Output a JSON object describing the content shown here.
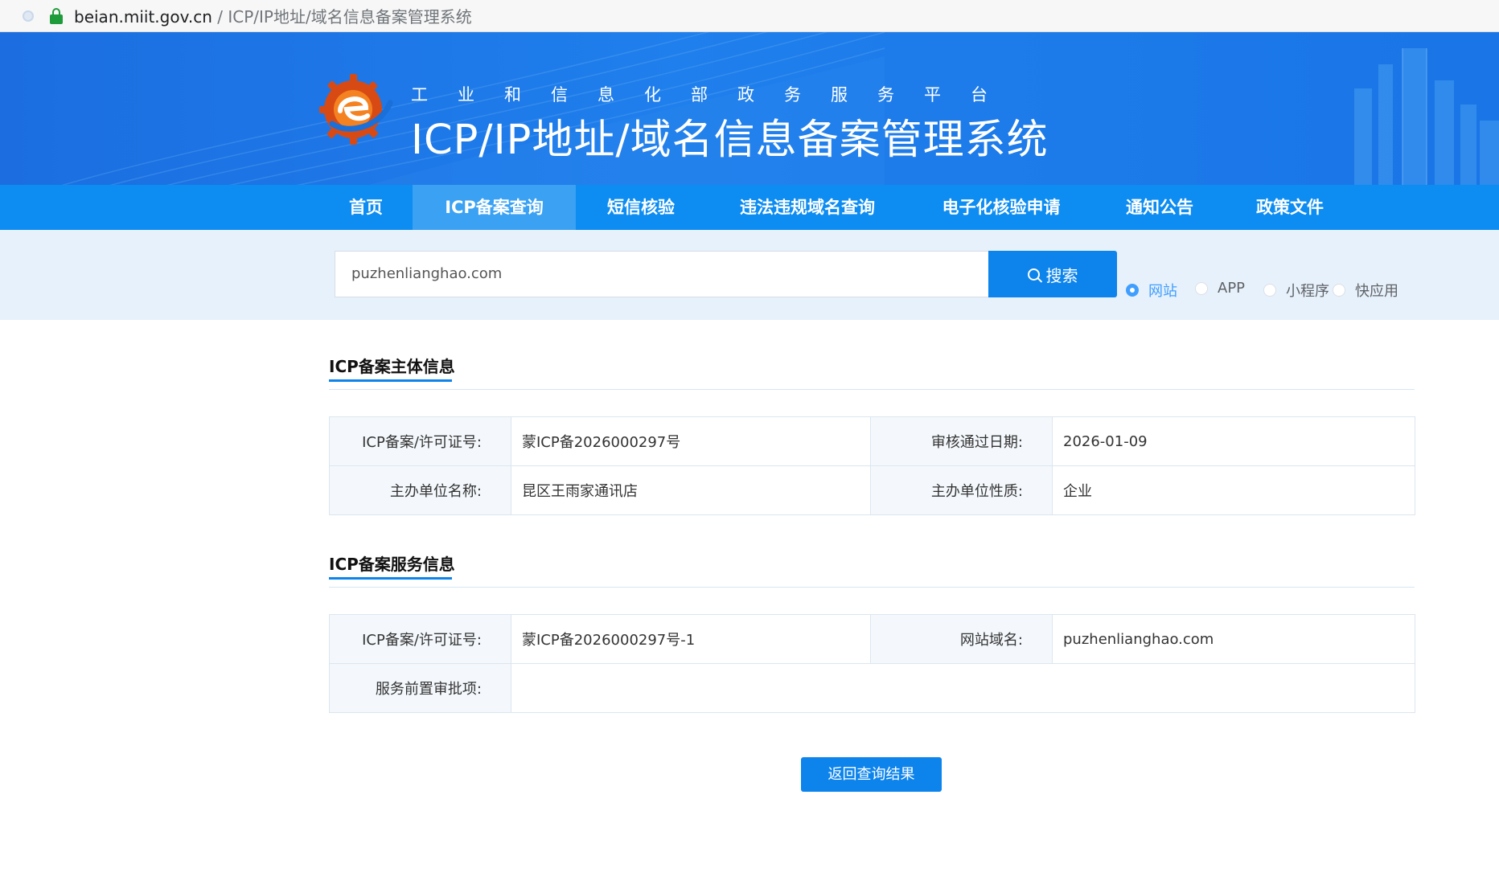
{
  "browser": {
    "url_host": "beian.miit.gov.cn",
    "url_path": " / ICP/IP地址/域名信息备案管理系统"
  },
  "header": {
    "subtitle": "工业和信息化部政务服务平台",
    "title": "ICP/IP地址/域名信息备案管理系统"
  },
  "nav": {
    "items": [
      {
        "label": "首页"
      },
      {
        "label": "ICP备案查询"
      },
      {
        "label": "短信核验"
      },
      {
        "label": "违法违规域名查询"
      },
      {
        "label": "电子化核验申请"
      },
      {
        "label": "通知公告"
      },
      {
        "label": "政策文件"
      }
    ],
    "active_index": 1
  },
  "search": {
    "value": "puzhenlianghao.com",
    "button_label": "搜索",
    "types": [
      {
        "label": "网站",
        "checked": true
      },
      {
        "label": "APP",
        "checked": false
      },
      {
        "label": "小程序",
        "checked": false
      },
      {
        "label": "快应用",
        "checked": false
      }
    ]
  },
  "subject_info": {
    "title": "ICP备案主体信息",
    "rows": [
      {
        "l1": "ICP备案/许可证号:",
        "v1": "蒙ICP备2026000297号",
        "l2": "审核通过日期:",
        "v2": "2026-01-09"
      },
      {
        "l1": "主办单位名称:",
        "v1": "昆区王雨家通讯店",
        "l2": "主办单位性质:",
        "v2": "企业"
      }
    ]
  },
  "service_info": {
    "title": "ICP备案服务信息",
    "license_label": "ICP备案/许可证号:",
    "license_value": "蒙ICP备2026000297号-1",
    "domain_label": "网站域名:",
    "domain_value": "puzhenlianghao.com",
    "approval_label": "服务前置审批项:",
    "approval_value": ""
  },
  "back_button": "返回查询结果",
  "colors": {
    "primary": "#0d84ec",
    "nav_bg": "#0d8cf1",
    "nav_active": "#3aa1f3",
    "search_band": "#e7f1fb",
    "radio_checked": "#409eff"
  }
}
